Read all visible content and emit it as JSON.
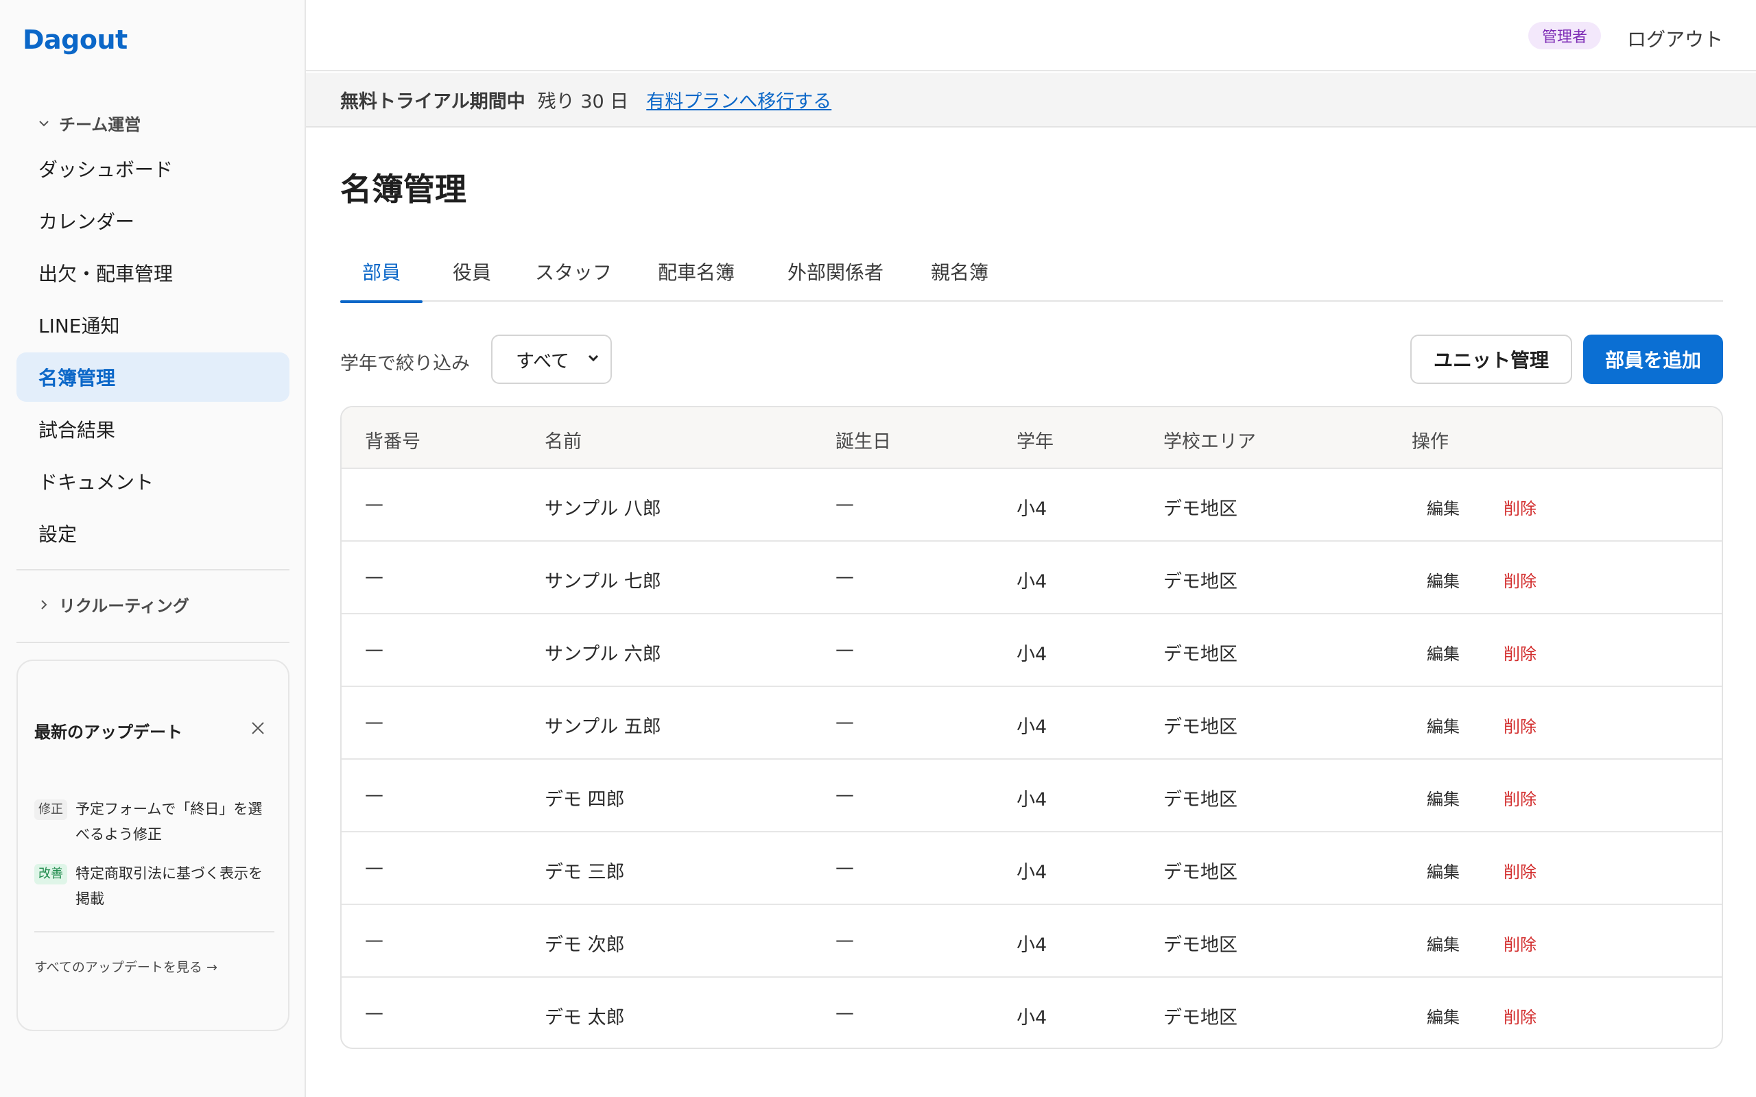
{
  "sidebar": {
    "logo": "Dagout",
    "group_team": "チーム運営",
    "items": [
      {
        "label": "ダッシュボード"
      },
      {
        "label": "カレンダー"
      },
      {
        "label": "出欠・配車管理"
      },
      {
        "label": "LINE通知"
      },
      {
        "label": "名簿管理"
      },
      {
        "label": "試合結果"
      },
      {
        "label": "ドキュメント"
      },
      {
        "label": "設定"
      }
    ],
    "group_recruit": "リクルーティング",
    "updates": {
      "title": "最新のアップデート",
      "entries": [
        {
          "badge": "修正",
          "text": "予定フォームで「終日」を選べるよう修正"
        },
        {
          "badge": "改善",
          "text": "特定商取引法に基づく表示を掲載"
        }
      ],
      "link": "すべてのアップデートを見る →"
    }
  },
  "header": {
    "role": "管理者",
    "logout": "ログアウト"
  },
  "trial": {
    "label": "無料トライアル期間中",
    "remaining": "残り 30 日",
    "link": "有料プランへ移行する"
  },
  "main": {
    "title": "名簿管理",
    "tabs": [
      {
        "label": "部員"
      },
      {
        "label": "役員"
      },
      {
        "label": "スタッフ"
      },
      {
        "label": "配車名簿"
      },
      {
        "label": "外部関係者"
      },
      {
        "label": "親名簿"
      }
    ],
    "filter_label": "学年で絞り込み",
    "filter_value": "すべて",
    "unit_button": "ユニット管理",
    "add_button": "部員を追加"
  },
  "table": {
    "columns": [
      "背番号",
      "名前",
      "誕生日",
      "学年",
      "学校エリア",
      "操作"
    ],
    "edit_label": "編集",
    "delete_label": "削除",
    "rows": [
      {
        "number": "—",
        "name": "サンプル 八郎",
        "birthday": "—",
        "grade": "小4",
        "area": "デモ地区"
      },
      {
        "number": "—",
        "name": "サンプル 七郎",
        "birthday": "—",
        "grade": "小4",
        "area": "デモ地区"
      },
      {
        "number": "—",
        "name": "サンプル 六郎",
        "birthday": "—",
        "grade": "小4",
        "area": "デモ地区"
      },
      {
        "number": "—",
        "name": "サンプル 五郎",
        "birthday": "—",
        "grade": "小4",
        "area": "デモ地区"
      },
      {
        "number": "—",
        "name": "デモ 四郎",
        "birthday": "—",
        "grade": "小4",
        "area": "デモ地区"
      },
      {
        "number": "—",
        "name": "デモ 三郎",
        "birthday": "—",
        "grade": "小4",
        "area": "デモ地区"
      },
      {
        "number": "—",
        "name": "デモ 次郎",
        "birthday": "—",
        "grade": "小4",
        "area": "デモ地区"
      },
      {
        "number": "—",
        "name": "デモ 太郎",
        "birthday": "—",
        "grade": "小4",
        "area": "デモ地区"
      }
    ]
  },
  "colors": {
    "accent": "#0b67c8",
    "primary_button": "#0b6fd3",
    "danger": "#d32f2f",
    "role_badge": "#7d2bb5"
  }
}
